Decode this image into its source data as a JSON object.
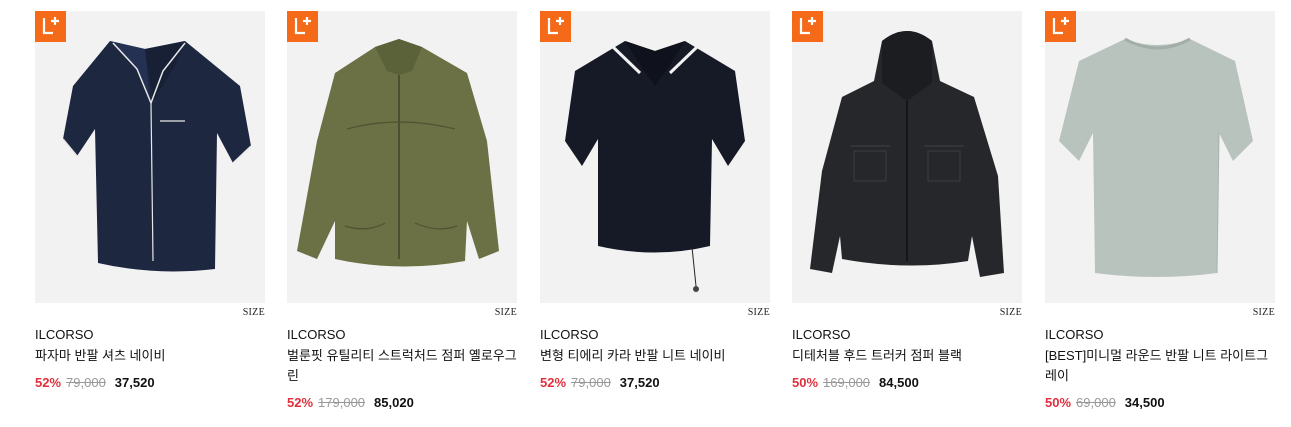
{
  "badge": {
    "icon": "l-plus-icon",
    "color": "#f46a18"
  },
  "size_label": "SIZE",
  "products": [
    {
      "brand": "ILCORSO",
      "name": "파자마 반팔 셔츠 네이비",
      "discount": "52%",
      "original_price": "79,000",
      "sale_price": "37,520",
      "image": "navy-pajama-shirt"
    },
    {
      "brand": "ILCORSO",
      "name": "벌룬핏 유틸리티 스트럭처드 점퍼 옐로우그린",
      "discount": "52%",
      "original_price": "179,000",
      "sale_price": "85,020",
      "image": "olive-utility-jumper"
    },
    {
      "brand": "ILCORSO",
      "name": "변형 티에리 카라 반팔 니트 네이비",
      "discount": "52%",
      "original_price": "79,000",
      "sale_price": "37,520",
      "image": "navy-collar-knit"
    },
    {
      "brand": "ILCORSO",
      "name": "디테처블 후드 트러커 점퍼 블랙",
      "discount": "50%",
      "original_price": "169,000",
      "sale_price": "84,500",
      "image": "black-hood-trucker"
    },
    {
      "brand": "ILCORSO",
      "name": "[BEST]미니멀 라운드 반팔 니트 라이트그레이",
      "discount": "50%",
      "original_price": "69,000",
      "sale_price": "34,500",
      "image": "lightgray-round-knit"
    }
  ]
}
